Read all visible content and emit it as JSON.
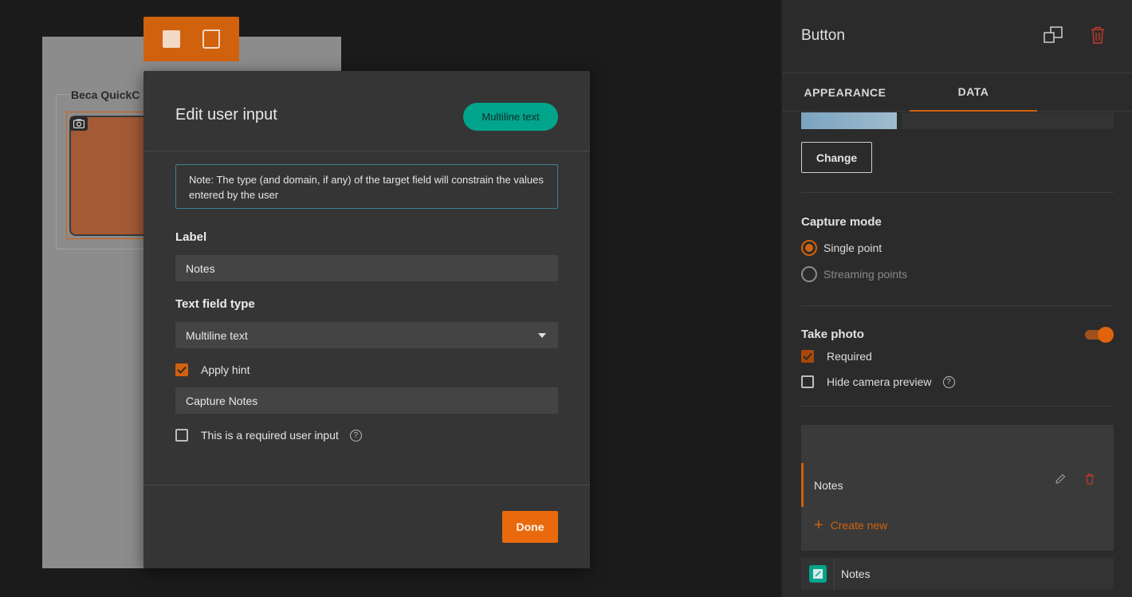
{
  "canvas": {
    "preview_title": "Beca QuickC"
  },
  "modal": {
    "title": "Edit user input",
    "type_pill": "Multiline text",
    "note": "Note: The type (and domain, if any) of the target field will constrain the values entered by the user",
    "label_heading": "Label",
    "label_value": "Notes",
    "field_type_heading": "Text field type",
    "field_type_value": "Multiline text",
    "apply_hint_label": "Apply hint",
    "apply_hint_checked": true,
    "hint_value": "Capture Notes",
    "required_label": "This is a required user input",
    "required_checked": false,
    "done_label": "Done"
  },
  "panel": {
    "title": "Button",
    "tabs": [
      {
        "label": "APPEARANCE",
        "active": false
      },
      {
        "label": "DATA",
        "active": true
      }
    ],
    "change_label": "Change",
    "capture_mode": {
      "title": "Capture mode",
      "options": [
        {
          "label": "Single point",
          "selected": true
        },
        {
          "label": "Streaming points",
          "selected": false
        }
      ]
    },
    "take_photo": {
      "title": "Take photo",
      "enabled": true,
      "required_label": "Required",
      "required_checked": true,
      "hide_preview_label": "Hide camera preview",
      "hide_preview_checked": false
    },
    "list": {
      "item_label": "Notes",
      "create_new_label": "Create new"
    },
    "bottom_item_label": "Notes"
  },
  "colors": {
    "accent": "#d1620d",
    "teal": "#00a58c",
    "danger": "#c0392b"
  }
}
